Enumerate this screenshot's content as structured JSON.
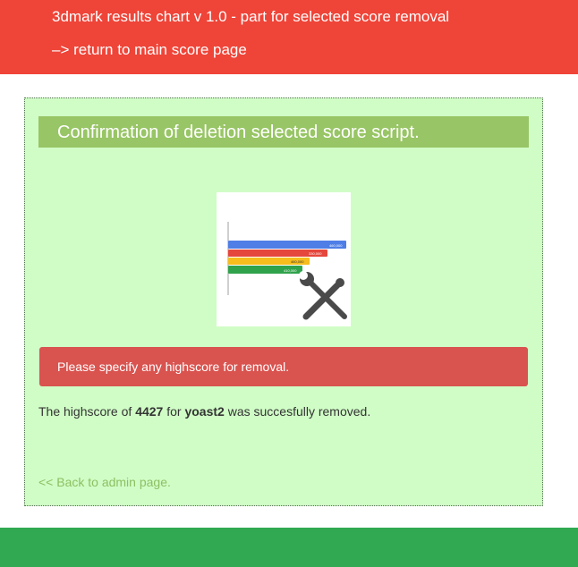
{
  "header": {
    "title": "3dmark results chart v 1.0 - part for selected score removal",
    "return_link": "–> return to main score page"
  },
  "panel": {
    "heading": "Confirmation of deletion selected score script.",
    "logo": {
      "icon": "chart-tools-logo-icon",
      "bar_labels": [
        "460,000",
        "330,000",
        "460,000",
        "410,000"
      ]
    },
    "alert": {
      "text": "Please specify any highscore for removal."
    },
    "result": {
      "prefix": "The highscore of",
      "score": "4427",
      "middle": "for",
      "user": "yoast2",
      "suffix": "was succesfully removed."
    },
    "back_link": "<< Back to admin page."
  },
  "colors": {
    "header_bg": "#ef4438",
    "panel_bg": "#d0fdc6",
    "heading_bg": "#98c565",
    "alert_bg": "#d9534f",
    "link_green": "#8dc063",
    "footer_bg": "#30a952"
  }
}
